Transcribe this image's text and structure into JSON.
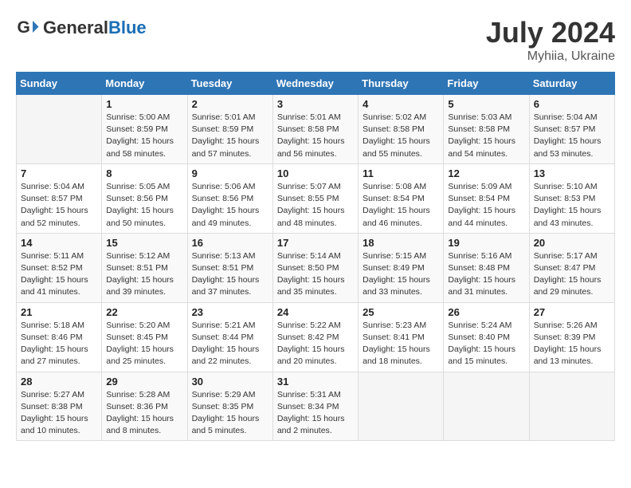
{
  "header": {
    "logo_general": "General",
    "logo_blue": "Blue",
    "month_year": "July 2024",
    "location": "Myhiia, Ukraine"
  },
  "calendar": {
    "columns": [
      "Sunday",
      "Monday",
      "Tuesday",
      "Wednesday",
      "Thursday",
      "Friday",
      "Saturday"
    ],
    "weeks": [
      [
        {
          "day": "",
          "info": ""
        },
        {
          "day": "1",
          "info": "Sunrise: 5:00 AM\nSunset: 8:59 PM\nDaylight: 15 hours\nand 58 minutes."
        },
        {
          "day": "2",
          "info": "Sunrise: 5:01 AM\nSunset: 8:59 PM\nDaylight: 15 hours\nand 57 minutes."
        },
        {
          "day": "3",
          "info": "Sunrise: 5:01 AM\nSunset: 8:58 PM\nDaylight: 15 hours\nand 56 minutes."
        },
        {
          "day": "4",
          "info": "Sunrise: 5:02 AM\nSunset: 8:58 PM\nDaylight: 15 hours\nand 55 minutes."
        },
        {
          "day": "5",
          "info": "Sunrise: 5:03 AM\nSunset: 8:58 PM\nDaylight: 15 hours\nand 54 minutes."
        },
        {
          "day": "6",
          "info": "Sunrise: 5:04 AM\nSunset: 8:57 PM\nDaylight: 15 hours\nand 53 minutes."
        }
      ],
      [
        {
          "day": "7",
          "info": "Sunrise: 5:04 AM\nSunset: 8:57 PM\nDaylight: 15 hours\nand 52 minutes."
        },
        {
          "day": "8",
          "info": "Sunrise: 5:05 AM\nSunset: 8:56 PM\nDaylight: 15 hours\nand 50 minutes."
        },
        {
          "day": "9",
          "info": "Sunrise: 5:06 AM\nSunset: 8:56 PM\nDaylight: 15 hours\nand 49 minutes."
        },
        {
          "day": "10",
          "info": "Sunrise: 5:07 AM\nSunset: 8:55 PM\nDaylight: 15 hours\nand 48 minutes."
        },
        {
          "day": "11",
          "info": "Sunrise: 5:08 AM\nSunset: 8:54 PM\nDaylight: 15 hours\nand 46 minutes."
        },
        {
          "day": "12",
          "info": "Sunrise: 5:09 AM\nSunset: 8:54 PM\nDaylight: 15 hours\nand 44 minutes."
        },
        {
          "day": "13",
          "info": "Sunrise: 5:10 AM\nSunset: 8:53 PM\nDaylight: 15 hours\nand 43 minutes."
        }
      ],
      [
        {
          "day": "14",
          "info": "Sunrise: 5:11 AM\nSunset: 8:52 PM\nDaylight: 15 hours\nand 41 minutes."
        },
        {
          "day": "15",
          "info": "Sunrise: 5:12 AM\nSunset: 8:51 PM\nDaylight: 15 hours\nand 39 minutes."
        },
        {
          "day": "16",
          "info": "Sunrise: 5:13 AM\nSunset: 8:51 PM\nDaylight: 15 hours\nand 37 minutes."
        },
        {
          "day": "17",
          "info": "Sunrise: 5:14 AM\nSunset: 8:50 PM\nDaylight: 15 hours\nand 35 minutes."
        },
        {
          "day": "18",
          "info": "Sunrise: 5:15 AM\nSunset: 8:49 PM\nDaylight: 15 hours\nand 33 minutes."
        },
        {
          "day": "19",
          "info": "Sunrise: 5:16 AM\nSunset: 8:48 PM\nDaylight: 15 hours\nand 31 minutes."
        },
        {
          "day": "20",
          "info": "Sunrise: 5:17 AM\nSunset: 8:47 PM\nDaylight: 15 hours\nand 29 minutes."
        }
      ],
      [
        {
          "day": "21",
          "info": "Sunrise: 5:18 AM\nSunset: 8:46 PM\nDaylight: 15 hours\nand 27 minutes."
        },
        {
          "day": "22",
          "info": "Sunrise: 5:20 AM\nSunset: 8:45 PM\nDaylight: 15 hours\nand 25 minutes."
        },
        {
          "day": "23",
          "info": "Sunrise: 5:21 AM\nSunset: 8:44 PM\nDaylight: 15 hours\nand 22 minutes."
        },
        {
          "day": "24",
          "info": "Sunrise: 5:22 AM\nSunset: 8:42 PM\nDaylight: 15 hours\nand 20 minutes."
        },
        {
          "day": "25",
          "info": "Sunrise: 5:23 AM\nSunset: 8:41 PM\nDaylight: 15 hours\nand 18 minutes."
        },
        {
          "day": "26",
          "info": "Sunrise: 5:24 AM\nSunset: 8:40 PM\nDaylight: 15 hours\nand 15 minutes."
        },
        {
          "day": "27",
          "info": "Sunrise: 5:26 AM\nSunset: 8:39 PM\nDaylight: 15 hours\nand 13 minutes."
        }
      ],
      [
        {
          "day": "28",
          "info": "Sunrise: 5:27 AM\nSunset: 8:38 PM\nDaylight: 15 hours\nand 10 minutes."
        },
        {
          "day": "29",
          "info": "Sunrise: 5:28 AM\nSunset: 8:36 PM\nDaylight: 15 hours\nand 8 minutes."
        },
        {
          "day": "30",
          "info": "Sunrise: 5:29 AM\nSunset: 8:35 PM\nDaylight: 15 hours\nand 5 minutes."
        },
        {
          "day": "31",
          "info": "Sunrise: 5:31 AM\nSunset: 8:34 PM\nDaylight: 15 hours\nand 2 minutes."
        },
        {
          "day": "",
          "info": ""
        },
        {
          "day": "",
          "info": ""
        },
        {
          "day": "",
          "info": ""
        }
      ]
    ]
  }
}
